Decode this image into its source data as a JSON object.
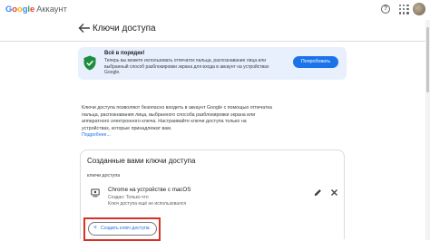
{
  "header": {
    "logo_brand": "Google",
    "logo_product": "Аккаунт",
    "help_icon": "help-circle-icon",
    "apps_icon": "apps-grid-icon"
  },
  "page": {
    "title": "Ключи доступа",
    "back_icon": "arrow-back-icon"
  },
  "banner": {
    "title": "Всё в порядке!",
    "text": "Теперь вы можете использовать отпечаток пальца, распознавание лица или выбранный способ разблокировки экрана для входа в аккаунт на устройствах Google.",
    "button": "Попробовать",
    "icon": "shield-check-icon"
  },
  "intro": {
    "text": "Ключи доступа позволяют безопасно входить в аккаунт Google с помощью отпечатка пальца, распознавания лица, выбранного способа разблокировки экрана или аппаратного электронного ключа. Настраивайте ключи доступа только на устройствах, которые принадлежат вам.",
    "more": "Подробнее..."
  },
  "passkeys": {
    "title": "Созданные вами ключи доступа",
    "subtitle": "ключи доступа",
    "items": [
      {
        "name": "Chrome на устройстве с macOS",
        "created": "Создан: Только что",
        "last_used": "Ключ доступа ещё не использовался"
      }
    ],
    "create_label": "Создать ключ доступа"
  },
  "colors": {
    "accent": "#1a73e8",
    "banner_bg": "#e8f0fe",
    "shield": "#1e8e3e",
    "highlight": "#d93025"
  }
}
